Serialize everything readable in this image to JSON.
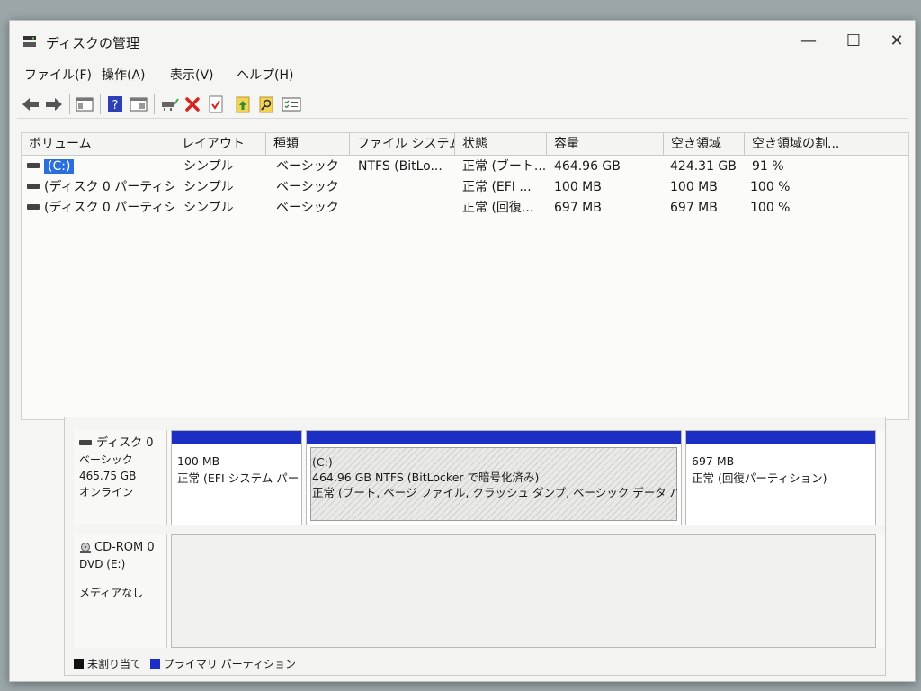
{
  "window": {
    "title": "ディスクの管理",
    "minimize": "—",
    "maximize": "☐",
    "close": "✕"
  },
  "menu": [
    "ファイル(F)",
    "操作(A)",
    "表示(V)",
    "ヘルプ(H)"
  ],
  "toolbar": {
    "icons": [
      "back-icon",
      "forward-icon",
      "console-tree-icon",
      "help-icon",
      "properties-icon",
      "connect-icon",
      "delete-icon",
      "check-icon",
      "up-folder-icon",
      "search-icon",
      "list-view-icon"
    ]
  },
  "columns": [
    "ボリューム",
    "レイアウト",
    "種類",
    "ファイル システム",
    "状態",
    "容量",
    "空き領域",
    "空き領域の割..."
  ],
  "rows": [
    {
      "volume": "(C:)",
      "layout": "シンプル",
      "type": "ベーシック",
      "fs": "NTFS (BitLo...",
      "status": "正常 (ブート...",
      "capacity": "464.96 GB",
      "free": "424.31 GB",
      "percent": "91 %"
    },
    {
      "volume": "(ディスク 0 パーティシ...",
      "layout": "シンプル",
      "type": "ベーシック",
      "fs": "",
      "status": "正常 (EFI ...",
      "capacity": "100 MB",
      "free": "100 MB",
      "percent": "100 %"
    },
    {
      "volume": "(ディスク 0 パーティシ...",
      "layout": "シンプル",
      "type": "ベーシック",
      "fs": "",
      "status": "正常 (回復...",
      "capacity": "697 MB",
      "free": "697 MB",
      "percent": "100 %"
    }
  ],
  "disks": [
    {
      "name": "ディスク 0",
      "kind": "ベーシック",
      "size": "465.75 GB",
      "state": "オンライン",
      "partitions": [
        {
          "line1": "100 MB",
          "line2": "正常 (EFI システム パー"
        },
        {
          "line1": "(C:)",
          "line2": "464.96 GB NTFS (BitLocker で暗号化済み)",
          "line3": "正常 (ブート, ページ ファイル, クラッシュ ダンプ, ベーシック データ パーティ"
        },
        {
          "line1": "697 MB",
          "line2": "正常 (回復パーティション)"
        }
      ]
    },
    {
      "name": "CD-ROM 0",
      "kind": "DVD (E:)",
      "state": "メディアなし"
    }
  ],
  "legend": {
    "unallocated": "未割り当て",
    "unallocated_color": "#111111",
    "primary": "プライマリ パーティション",
    "primary_color": "#1c2fc4"
  }
}
